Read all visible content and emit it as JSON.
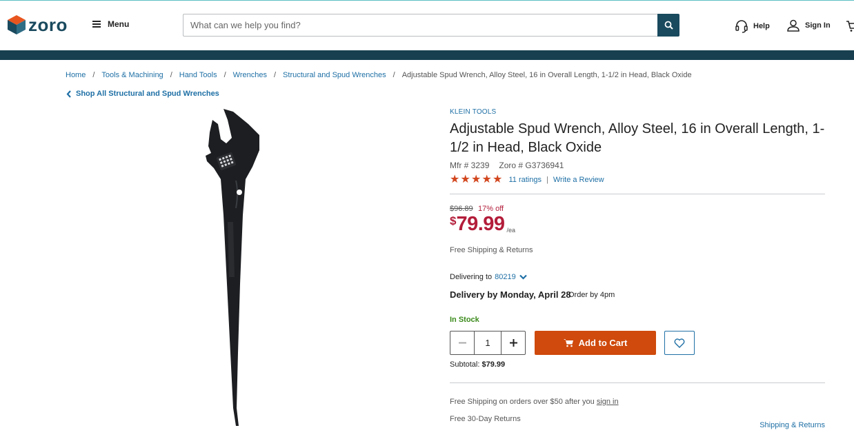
{
  "header": {
    "logo_text": "zoro",
    "menu_label": "Menu",
    "search_placeholder": "What can we help you find?",
    "help_label": "Help",
    "signin_label": "Sign In"
  },
  "promo_bar": {
    "text": ""
  },
  "breadcrumb": {
    "items": [
      "Home",
      "Tools & Machining",
      "Hand Tools",
      "Wrenches",
      "Structural and Spud Wrenches"
    ],
    "current": "Adjustable Spud Wrench, Alloy Steel, 16 in Overall Length, 1-1/2 in Head, Black Oxide",
    "separator": "/"
  },
  "back_link": "Shop All Structural and Spud Wrenches",
  "product": {
    "brand": "KLEIN TOOLS",
    "title": "Adjustable Spud Wrench, Alloy Steel, 16 in Overall Length, 1-1/2 in Head, Black Oxide",
    "mfr": "Mfr # 3239",
    "zoro_sku": "Zoro # G3736941",
    "rating": 5,
    "ratings_count": "11 ratings",
    "write_review": "Write a Review",
    "old_price": "$96.89",
    "discount": "17% off",
    "price_symbol": "$",
    "price": "79.99",
    "price_unit": "/ea",
    "free_shipping": "Free Shipping & Returns",
    "delivering_to_label": "Delivering to",
    "zip": "80219",
    "delivery_date": "Delivery by Monday, April 28",
    "order_by": "Order by 4pm",
    "stock_status": "In Stock",
    "quantity": "1",
    "add_to_cart": "Add to Cart",
    "subtotal_label": "Subtotal:",
    "subtotal_value": "$79.99",
    "ship_note_prefix": "Free Shipping on orders over $50 after you",
    "ship_note_link": "sign in",
    "returns_note": "Free 30-Day Returns",
    "shipping_returns_link": "Shipping & Returns"
  },
  "colors": {
    "brand_dark": "#1a4a5e",
    "link_blue": "#1e6fa5",
    "price_red": "#b31d3a",
    "cta_orange": "#cf4a0c",
    "star_orange": "#d2461e",
    "stock_green": "#3a8a1a"
  }
}
